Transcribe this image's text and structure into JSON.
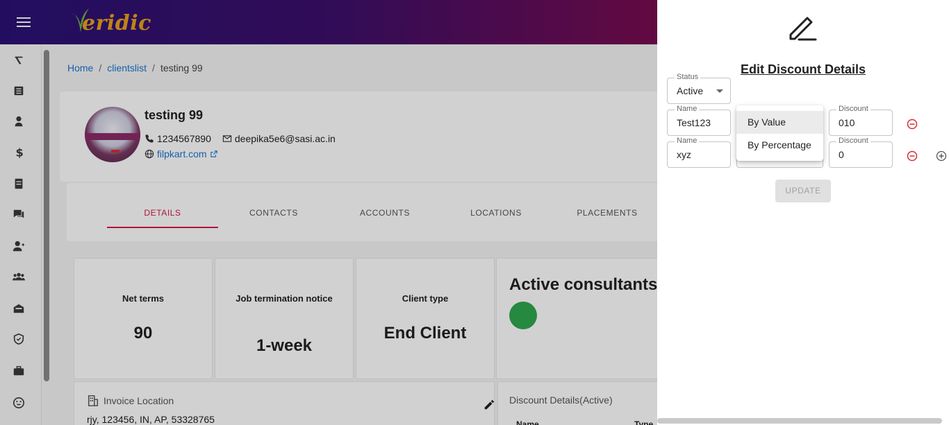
{
  "app": {
    "logo_text": "eridic"
  },
  "breadcrumb": {
    "home": "Home",
    "clientslist": "clientslist",
    "current": "testing 99"
  },
  "client": {
    "name": "testing 99",
    "phone": "1234567890",
    "email": "deepika5e6@sasi.ac.in",
    "website": "filpkart.com"
  },
  "tabs": [
    {
      "label": "DETAILS"
    },
    {
      "label": "CONTACTS"
    },
    {
      "label": "ACCOUNTS"
    },
    {
      "label": "LOCATIONS"
    },
    {
      "label": "PLACEMENTS"
    }
  ],
  "stats": [
    {
      "label": "Net terms",
      "value": "90"
    },
    {
      "label": "Job termination notice",
      "value": "1-week"
    },
    {
      "label": "Client type",
      "value": "End Client"
    }
  ],
  "active_consultants": {
    "title": "Active consultants ("
  },
  "invoice": {
    "title": "Invoice Location",
    "address": "rjy, 123456, IN, AP, 53328765"
  },
  "discount_panel": {
    "title": "Discount Details(Active)",
    "col_name": "Name",
    "col_type": "Type"
  },
  "drawer": {
    "title": "Edit Discount Details",
    "status": {
      "label": "Status",
      "value": "Active"
    },
    "rows": [
      {
        "name_label": "Name",
        "name_value": "Test123",
        "discount_label": "Discount",
        "discount_value": "010"
      },
      {
        "name_label": "Name",
        "name_value": "xyz",
        "discount_label": "Discount",
        "discount_value": "0"
      }
    ],
    "update_label": "UPDATE"
  },
  "type_menu": {
    "options": [
      "By Value",
      "By Percentage"
    ],
    "selected": "By Value"
  },
  "colors": {
    "accent": "#d8194c",
    "link": "#1976d2",
    "remove": "#d32f2f",
    "status_green": "#2ea84d"
  }
}
